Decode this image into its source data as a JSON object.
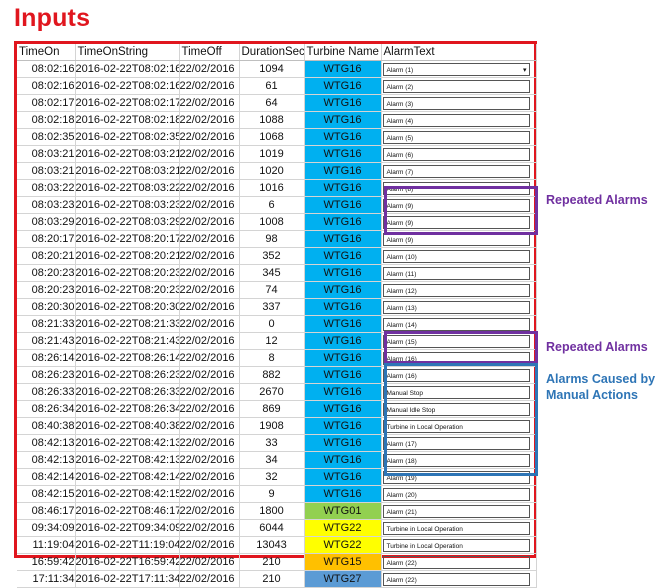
{
  "title": "Inputs",
  "columns": [
    "TimeOn",
    "TimeOnString",
    "TimeOff",
    "DurationSec",
    "Turbine Name",
    "AlarmText"
  ],
  "rows": [
    {
      "on": "08:02:16",
      "str": "2016-02-22T08:02:16",
      "off": "22/02/2016",
      "dur": "1094",
      "tur": "WTG16",
      "bg": "#00b0f0",
      "alarm": "Alarm (1)"
    },
    {
      "on": "08:02:16",
      "str": "2016-02-22T08:02:16",
      "off": "22/02/2016",
      "dur": "61",
      "tur": "WTG16",
      "bg": "#00b0f0",
      "alarm": "Alarm (2)"
    },
    {
      "on": "08:02:17",
      "str": "2016-02-22T08:02:17",
      "off": "22/02/2016",
      "dur": "64",
      "tur": "WTG16",
      "bg": "#00b0f0",
      "alarm": "Alarm (3)"
    },
    {
      "on": "08:02:18",
      "str": "2016-02-22T08:02:18",
      "off": "22/02/2016",
      "dur": "1088",
      "tur": "WTG16",
      "bg": "#00b0f0",
      "alarm": "Alarm (4)"
    },
    {
      "on": "08:02:35",
      "str": "2016-02-22T08:02:35",
      "off": "22/02/2016",
      "dur": "1068",
      "tur": "WTG16",
      "bg": "#00b0f0",
      "alarm": "Alarm (5)"
    },
    {
      "on": "08:03:21",
      "str": "2016-02-22T08:03:21",
      "off": "22/02/2016",
      "dur": "1019",
      "tur": "WTG16",
      "bg": "#00b0f0",
      "alarm": "Alarm (6)"
    },
    {
      "on": "08:03:21",
      "str": "2016-02-22T08:03:21",
      "off": "22/02/2016",
      "dur": "1020",
      "tur": "WTG16",
      "bg": "#00b0f0",
      "alarm": "Alarm (7)"
    },
    {
      "on": "08:03:22",
      "str": "2016-02-22T08:03:22",
      "off": "22/02/2016",
      "dur": "1016",
      "tur": "WTG16",
      "bg": "#00b0f0",
      "alarm": "Alarm (8)"
    },
    {
      "on": "08:03:23",
      "str": "2016-02-22T08:03:23",
      "off": "22/02/2016",
      "dur": "6",
      "tur": "WTG16",
      "bg": "#00b0f0",
      "alarm": "Alarm (9)"
    },
    {
      "on": "08:03:29",
      "str": "2016-02-22T08:03:29",
      "off": "22/02/2016",
      "dur": "1008",
      "tur": "WTG16",
      "bg": "#00b0f0",
      "alarm": "Alarm (9)"
    },
    {
      "on": "08:20:17",
      "str": "2016-02-22T08:20:17",
      "off": "22/02/2016",
      "dur": "98",
      "tur": "WTG16",
      "bg": "#00b0f0",
      "alarm": "Alarm (9)"
    },
    {
      "on": "08:20:21",
      "str": "2016-02-22T08:20:21",
      "off": "22/02/2016",
      "dur": "352",
      "tur": "WTG16",
      "bg": "#00b0f0",
      "alarm": "Alarm (10)"
    },
    {
      "on": "08:20:23",
      "str": "2016-02-22T08:20:23",
      "off": "22/02/2016",
      "dur": "345",
      "tur": "WTG16",
      "bg": "#00b0f0",
      "alarm": "Alarm (11)"
    },
    {
      "on": "08:20:23",
      "str": "2016-02-22T08:20:23",
      "off": "22/02/2016",
      "dur": "74",
      "tur": "WTG16",
      "bg": "#00b0f0",
      "alarm": "Alarm (12)"
    },
    {
      "on": "08:20:30",
      "str": "2016-02-22T08:20:30",
      "off": "22/02/2016",
      "dur": "337",
      "tur": "WTG16",
      "bg": "#00b0f0",
      "alarm": "Alarm (13)"
    },
    {
      "on": "08:21:33",
      "str": "2016-02-22T08:21:33",
      "off": "22/02/2016",
      "dur": "0",
      "tur": "WTG16",
      "bg": "#00b0f0",
      "alarm": "Alarm (14)"
    },
    {
      "on": "08:21:43",
      "str": "2016-02-22T08:21:43",
      "off": "22/02/2016",
      "dur": "12",
      "tur": "WTG16",
      "bg": "#00b0f0",
      "alarm": "Alarm (15)"
    },
    {
      "on": "08:26:14",
      "str": "2016-02-22T08:26:14",
      "off": "22/02/2016",
      "dur": "8",
      "tur": "WTG16",
      "bg": "#00b0f0",
      "alarm": "Alarm (16)"
    },
    {
      "on": "08:26:23",
      "str": "2016-02-22T08:26:23",
      "off": "22/02/2016",
      "dur": "882",
      "tur": "WTG16",
      "bg": "#00b0f0",
      "alarm": "Alarm (16)"
    },
    {
      "on": "08:26:33",
      "str": "2016-02-22T08:26:33",
      "off": "22/02/2016",
      "dur": "2670",
      "tur": "WTG16",
      "bg": "#00b0f0",
      "alarm": "Manual Stop"
    },
    {
      "on": "08:26:34",
      "str": "2016-02-22T08:26:34",
      "off": "22/02/2016",
      "dur": "869",
      "tur": "WTG16",
      "bg": "#00b0f0",
      "alarm": "Manual Idle Stop"
    },
    {
      "on": "08:40:38",
      "str": "2016-02-22T08:40:38",
      "off": "22/02/2016",
      "dur": "1908",
      "tur": "WTG16",
      "bg": "#00b0f0",
      "alarm": "Turbine in Local Operation"
    },
    {
      "on": "08:42:13",
      "str": "2016-02-22T08:42:13",
      "off": "22/02/2016",
      "dur": "33",
      "tur": "WTG16",
      "bg": "#00b0f0",
      "alarm": "Alarm (17)"
    },
    {
      "on": "08:42:13",
      "str": "2016-02-22T08:42:13",
      "off": "22/02/2016",
      "dur": "34",
      "tur": "WTG16",
      "bg": "#00b0f0",
      "alarm": "Alarm (18)"
    },
    {
      "on": "08:42:14",
      "str": "2016-02-22T08:42:14",
      "off": "22/02/2016",
      "dur": "32",
      "tur": "WTG16",
      "bg": "#00b0f0",
      "alarm": "Alarm (19)"
    },
    {
      "on": "08:42:15",
      "str": "2016-02-22T08:42:15",
      "off": "22/02/2016",
      "dur": "9",
      "tur": "WTG16",
      "bg": "#00b0f0",
      "alarm": "Alarm (20)"
    },
    {
      "on": "08:46:17",
      "str": "2016-02-22T08:46:17",
      "off": "22/02/2016",
      "dur": "1800",
      "tur": "WTG01",
      "bg": "#92d050",
      "alarm": "Alarm (21)"
    },
    {
      "on": "09:34:09",
      "str": "2016-02-22T09:34:09",
      "off": "22/02/2016",
      "dur": "6044",
      "tur": "WTG22",
      "bg": "#ffff00",
      "alarm": "Turbine in Local Operation"
    },
    {
      "on": "11:19:04",
      "str": "2016-02-22T11:19:04",
      "off": "22/02/2016",
      "dur": "13043",
      "tur": "WTG22",
      "bg": "#ffff00",
      "alarm": "Turbine in Local Operation"
    },
    {
      "on": "16:59:42",
      "str": "2016-02-22T16:59:42",
      "off": "22/02/2016",
      "dur": "210",
      "tur": "WTG15",
      "bg": "#ffc000",
      "alarm": "Alarm (22)"
    },
    {
      "on": "17:11:34",
      "str": "2016-02-22T17:11:34",
      "off": "22/02/2016",
      "dur": "210",
      "tur": "WTG27",
      "bg": "#5b9bd5",
      "alarm": "Alarm (22)"
    }
  ],
  "first_row_mark": "▾",
  "annotations": {
    "repeated1": "Repeated Alarms",
    "repeated2": "Repeated Alarms",
    "manual_line1": "Alarms Caused by",
    "manual_line2": "Manual Actions"
  },
  "colors": {
    "title": "#e0161e",
    "frame": "#e0161e",
    "repeated": "#7030a0",
    "manual": "#2e75b6"
  }
}
